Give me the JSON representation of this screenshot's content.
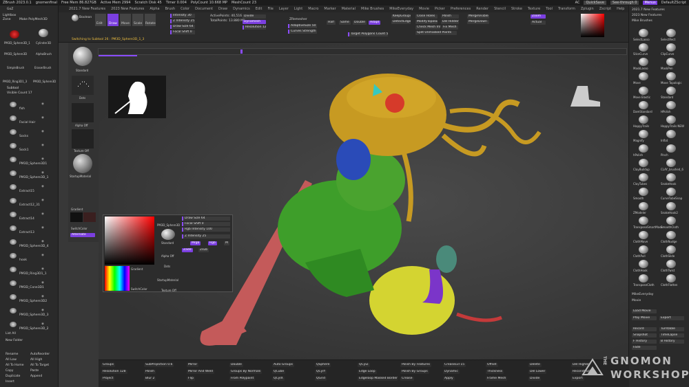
{
  "menubar": {
    "items": [
      "ZBrush 2023.0.1",
      "gnomenfinal",
      "Free Mem 86.827GB",
      "Active Mem 2994",
      "Scratch Disk 45",
      "Timer 0.004",
      "PolyCount 10.668 MP",
      "MeshCount 23"
    ],
    "right": [
      "AC",
      "QuickSave",
      "See-through 0",
      "Menus",
      "DefaultZScript"
    ]
  },
  "menu2": [
    "2021.7 New Features",
    "2023 New Features",
    "Alpha",
    "Brush",
    "Color",
    "Document",
    "Draw",
    "Dynamics",
    "Edit",
    "File",
    "Layer",
    "Light",
    "Macro",
    "Marker",
    "Material",
    "Mike Brushes",
    "MikeEveryday",
    "Movie",
    "Picker",
    "Preferences",
    "Render",
    "Stencil",
    "Stroke",
    "Texture",
    "Tool",
    "Transform",
    "Zplugin",
    "Zscript",
    "Help"
  ],
  "left_top": [
    "Lightbox",
    "Tools",
    "Zone",
    "Make PolyMesh3D",
    "GoZ",
    "All",
    "Visible",
    "R"
  ],
  "left_tools": [
    "PM3D_Sphere3D_1",
    "Cylinder3D",
    "PM3D_Sphere3D",
    "AlphaBrush",
    "SimpleBrush",
    "EraserBrush",
    "PM3D_Ring3D1_3",
    "PM3D_Sphere3D"
  ],
  "subtool": {
    "title": "Subtool",
    "visible_count": "Visible Count 17",
    "items": [
      "fish",
      "Facial Hair",
      "Socks",
      "Sock1",
      "PM3D_Sphere3D1",
      "PM3D_Sphere3D_1",
      "Extract15",
      "Extract12_31",
      "Extract14",
      "Extract13",
      "PM3D_Sphere3D_4",
      "hook",
      "PM3D_Ring3D1_1",
      "PM3D_Cone3D1",
      "PM3D_Sphere3D2",
      "PM3D_Sphere3D_3",
      "PM3D_Sphere3D_2"
    ]
  },
  "left_bottom": [
    "List All",
    "New Folder",
    "Rename",
    "AutoReorder",
    "All Low",
    "All High",
    "All To Home",
    "All To Target",
    "Copy",
    "Paste",
    "Duplicate",
    "Append",
    "Insert"
  ],
  "left2": [
    "Standard",
    "Dots",
    "Alpha Off",
    "Texture Off",
    "StartupMaterial",
    "Gradient",
    "SwitchColor",
    "Alternate"
  ],
  "topshelf": {
    "buttons": [
      "Boolean",
      "Edit",
      "Draw",
      "Move",
      "Scale",
      "Rotate"
    ],
    "sliders": [
      "Intensity 30",
      "Z Intensity 25",
      "Draw Size 64",
      "Focal Shift 0",
      "Rgb Intensity 100"
    ],
    "info": [
      "ActivePoints: 40,516",
      "TotalPoints: 13.880 Mil",
      "Divide",
      "Dynamesh",
      "Resolution 128",
      "AdaptiveSize 50",
      "Curves Strength 50",
      "ZRemesher",
      "Target Polygons Count 5",
      "KeepGroups",
      "DetectEdges",
      "Close Holes",
      "ModifyTopology",
      "Polish",
      "Del Hidden",
      "Check Mesh Int",
      "Fix Mesh",
      "Split Unmasked Points",
      "MergeVisible",
      "MergeDown",
      "Half",
      "Same",
      "Double",
      "Adapt",
      "Zoom",
      "Actual"
    ],
    "status": "Switching to Subtool 26 : PM3D_Sphere3D_1_3"
  },
  "popup": {
    "tool": "PM3D_Sphere3D",
    "sliders": [
      "Draw Size 64",
      "Focal Shift 0",
      "Rgb Intensity 100",
      "Z Intensity 25"
    ],
    "labels": [
      "Standard",
      "Alpha Off",
      "Texture Off",
      "Dots",
      "StartupMaterial",
      "Gradient",
      "SwitchColor",
      "Mrgb",
      "Rgb",
      "M",
      "Zadd",
      "Zsub"
    ]
  },
  "right": {
    "top": [
      "2021.7 New Features",
      "2023 New Features",
      "Mike Brushes"
    ],
    "brushes": [
      "SelectLasso",
      "SelectRect",
      "SliceCurve",
      "ClipCurve",
      "MaskLasso",
      "MaskPen",
      "Move",
      "Move Topologic",
      "Move Elastic",
      "Standard",
      "DamStandard",
      "HPolish",
      "HappyTrails",
      "HappyTrails NEW",
      "Magnify",
      "Inflat",
      "hPolish",
      "Pinch",
      "ClayBuildup",
      "CLAY_brushed_6",
      "ClayTubes",
      "SnakeHook",
      "Smooth",
      "CurveTubeSnap",
      "ZModeler",
      "SnakeHook2",
      "TransposeSmartMask",
      "SmoothCloth",
      "ClothMove",
      "ClothNudge",
      "ClothPull",
      "ClothSlide",
      "ClothHook",
      "ClothTwist",
      "TransposeCloth",
      "ClothFlatten"
    ],
    "sections": [
      "MikeEveryday",
      "Movie"
    ],
    "movie": [
      "Load Movie",
      "Play Movie",
      "Export",
      "Record",
      "Turntable",
      "Snapshot",
      "TimeLapse",
      "F History",
      "B History",
      "Fade"
    ]
  },
  "bottom": [
    "Groups",
    "Resolution 128",
    "Project",
    "SubProjection 0.6",
    "Polish",
    "Blur 2",
    "Mirror",
    "Mirror And Weld",
    "Flip",
    "Double",
    "Groups By Normals",
    "From Polypaint",
    "Auto Groups",
    "QCube",
    "QCylX",
    "QSphere",
    "QCylY",
    "QGrid",
    "QCylZ",
    "Edge Loop",
    "Edgeloop Masked Border",
    "Polish By Features",
    "Polish By Groups",
    "Crease",
    "CreaseLvl 15",
    "Dynamic",
    "Apply",
    "Offset",
    "Thickness",
    "Frame Mesh",
    "Delete",
    "Del Lower",
    "Divide",
    "Del Higher",
    "Reconstruct",
    "Export"
  ],
  "watermark": {
    "the": "THE",
    "line1": "GNOMON",
    "line2": "WORKSHOP"
  },
  "colors": {
    "accent": "#7b3fe0",
    "bg": "#383838",
    "panel": "#2a2a2a"
  }
}
